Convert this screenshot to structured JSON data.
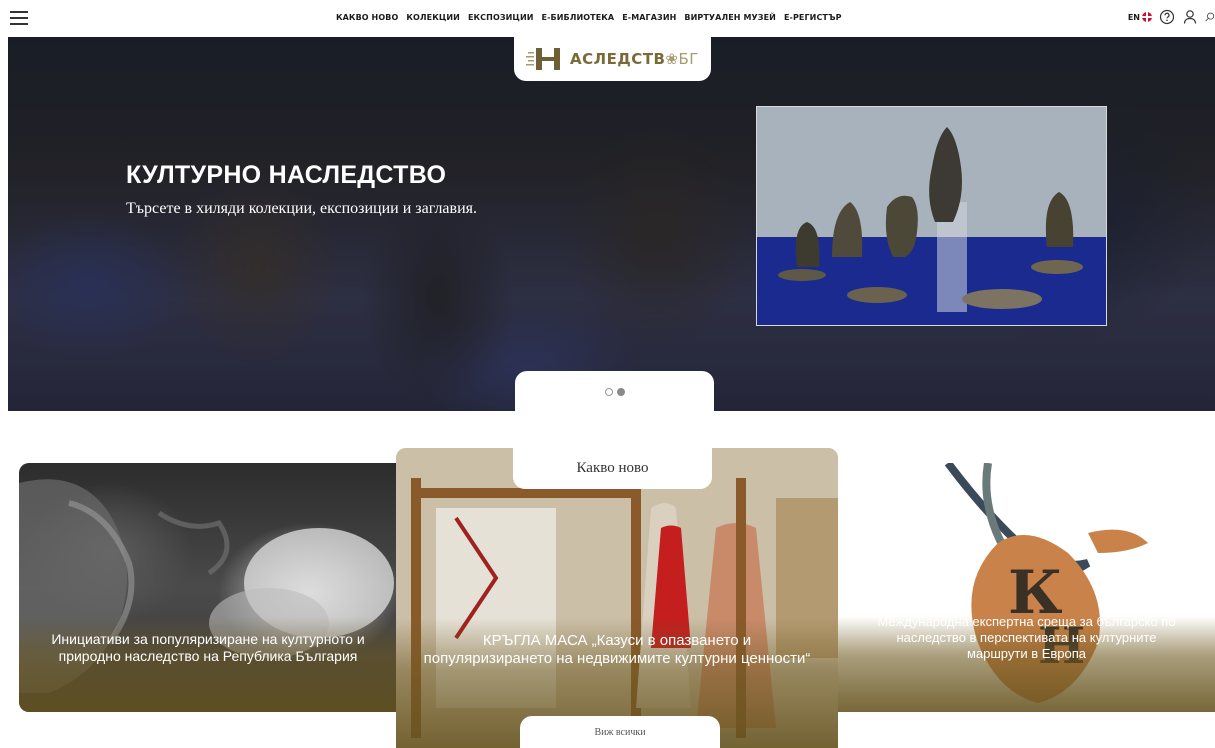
{
  "nav": {
    "items": [
      "КАКВО НОВО",
      "КОЛЕКЦИИ",
      "ЕКСПОЗИЦИИ",
      "Е-БИБЛИОТЕКА",
      "Е-МАГАЗИН",
      "ВИРТУАЛЕН МУЗЕЙ",
      "Е-РЕГИСТЪР"
    ],
    "lang": "EN"
  },
  "logo": {
    "text": "АСЛЕДСТВ",
    "suffix": "БГ"
  },
  "hero": {
    "title": "КУЛТУРНО НАСЛЕДСТВО",
    "subtitle": "Търсете в хиляди колекции, експозиции и заглавия.",
    "slides": 2,
    "active_slide": 2
  },
  "news": {
    "heading": "Какво ново",
    "cards": [
      "Инициативи за популяризиране на културното и природно наследство на Република България",
      "КРЪГЛА МАСА „Казуси в опазването и популяризирането на недвижимите културни ценности“",
      "Международна експертна среща за българско по наследство в перспективата на културните маршрути в Европа"
    ],
    "see_all": "Виж всички"
  },
  "colors": {
    "accent": "#7a6a3a",
    "overlay": "#6e5a23"
  }
}
